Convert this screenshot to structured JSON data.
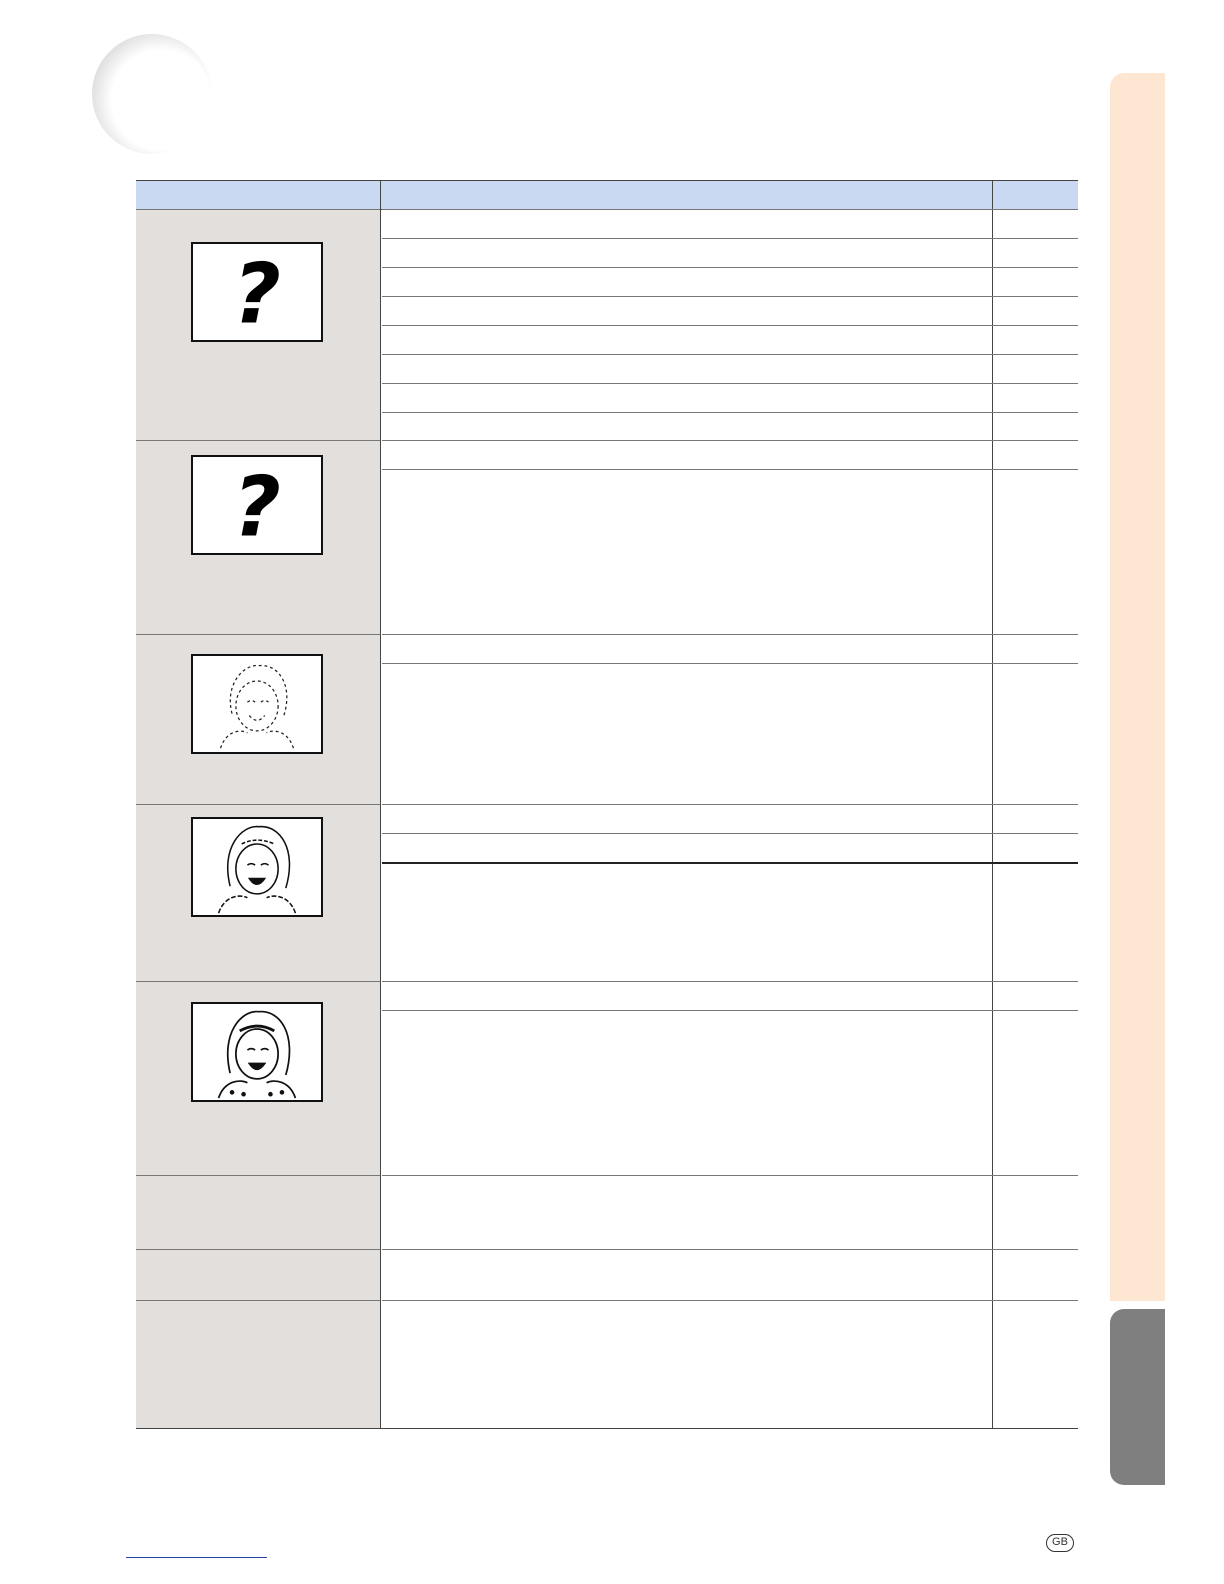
{
  "page": {
    "badge": "GB",
    "colors": {
      "header_fill": "#c9d9f2",
      "problem_column_fill": "#e3dfdc",
      "side_tab_light": "#fde6d2",
      "side_tab_dark": "#7f7f7f",
      "footer_link": "#2244aa"
    }
  },
  "table": {
    "headers": {
      "problem": "",
      "check": "",
      "page": ""
    },
    "groups": [
      {
        "illustration": "question-mark-icon",
        "rows": [
          {
            "check": "",
            "page": ""
          },
          {
            "check": "",
            "page": ""
          },
          {
            "check": "",
            "page": ""
          },
          {
            "check": "",
            "page": ""
          },
          {
            "check": "",
            "page": ""
          },
          {
            "check": "",
            "page": ""
          },
          {
            "check": "",
            "page": ""
          },
          {
            "check": "",
            "page": ""
          }
        ]
      },
      {
        "illustration": "question-mark-icon",
        "rows": [
          {
            "check": "",
            "page": ""
          },
          {
            "check": "",
            "page": ""
          }
        ]
      },
      {
        "illustration": "faded-face-image",
        "rows": [
          {
            "check": "",
            "page": ""
          },
          {
            "check": "",
            "page": ""
          }
        ]
      },
      {
        "illustration": "partly-faded-face-image",
        "rows": [
          {
            "check": "",
            "page": ""
          },
          {
            "check": "",
            "page": ""
          },
          {
            "check": "",
            "page": ""
          }
        ]
      },
      {
        "illustration": "clear-face-image",
        "rows": [
          {
            "check": "",
            "page": ""
          },
          {
            "check": "",
            "page": ""
          }
        ]
      },
      {
        "illustration": "",
        "rows": [
          {
            "check": "",
            "page": ""
          }
        ]
      },
      {
        "illustration": "",
        "rows": [
          {
            "check": "",
            "page": ""
          }
        ]
      },
      {
        "illustration": "",
        "rows": [
          {
            "check": "",
            "page": ""
          }
        ]
      }
    ]
  }
}
